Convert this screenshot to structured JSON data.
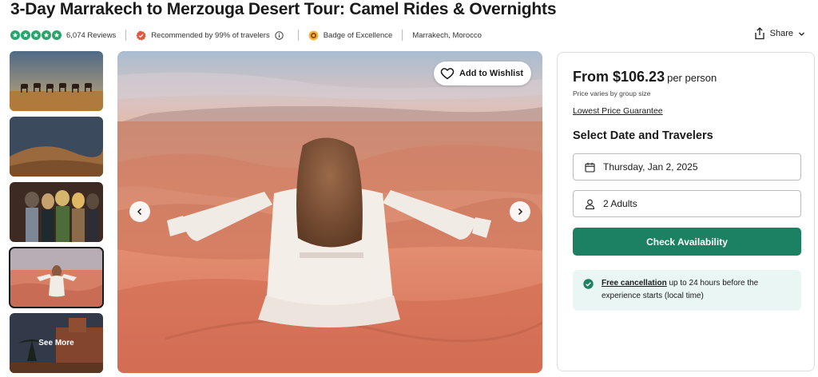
{
  "title": "3-Day Marrakech to Merzouga Desert Tour: Camel Rides & Overnights",
  "meta": {
    "rating_stars": 5,
    "reviews": "6,074 Reviews",
    "recommended": "Recommended by 99% of travelers",
    "badge": "Badge of Excellence",
    "location": "Marrakech, Morocco",
    "share": "Share"
  },
  "gallery": {
    "see_more": "See More",
    "wishlist": "Add to Wishlist",
    "thumbnails": [
      "camel-caravan",
      "dunes",
      "travelers-group",
      "woman-dunes",
      "kasbah"
    ],
    "selected_thumbnail": 4
  },
  "booking": {
    "price_prefix": "From ",
    "price": "$106.23",
    "price_suffix": "per person",
    "price_note": "Price varies by group size",
    "guarantee": "Lowest Price Guarantee",
    "section_title": "Select Date and Travelers",
    "date": "Thursday, Jan 2, 2025",
    "travelers": "2 Adults",
    "cta": "Check Availability",
    "cancel_link": "Free cancellation",
    "cancel_text": " up to 24 hours before the experience starts (local time)"
  },
  "colors": {
    "accent": "#1c8162",
    "star": "#2ba36b",
    "notice_bg": "#e9f6f4"
  }
}
